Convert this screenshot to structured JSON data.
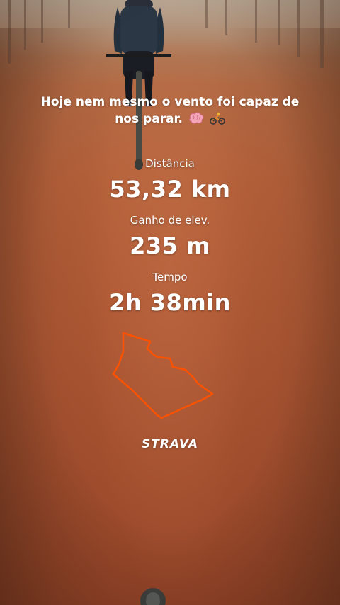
{
  "activity": {
    "caption": "Hoje nem mesmo o vento foi capaz de nos parar.",
    "caption_emojis": [
      "brain-emoji",
      "biking-person-emoji"
    ],
    "stats": [
      {
        "label": "Distância",
        "value": "53,32 km"
      },
      {
        "label": "Ganho de elev.",
        "value": "235 m"
      },
      {
        "label": "Tempo",
        "value": "2h 38min"
      }
    ],
    "brand": "STRAVA"
  },
  "colors": {
    "text": "#ffffff",
    "route_line": "#fc5200",
    "road": "#b5613a"
  }
}
